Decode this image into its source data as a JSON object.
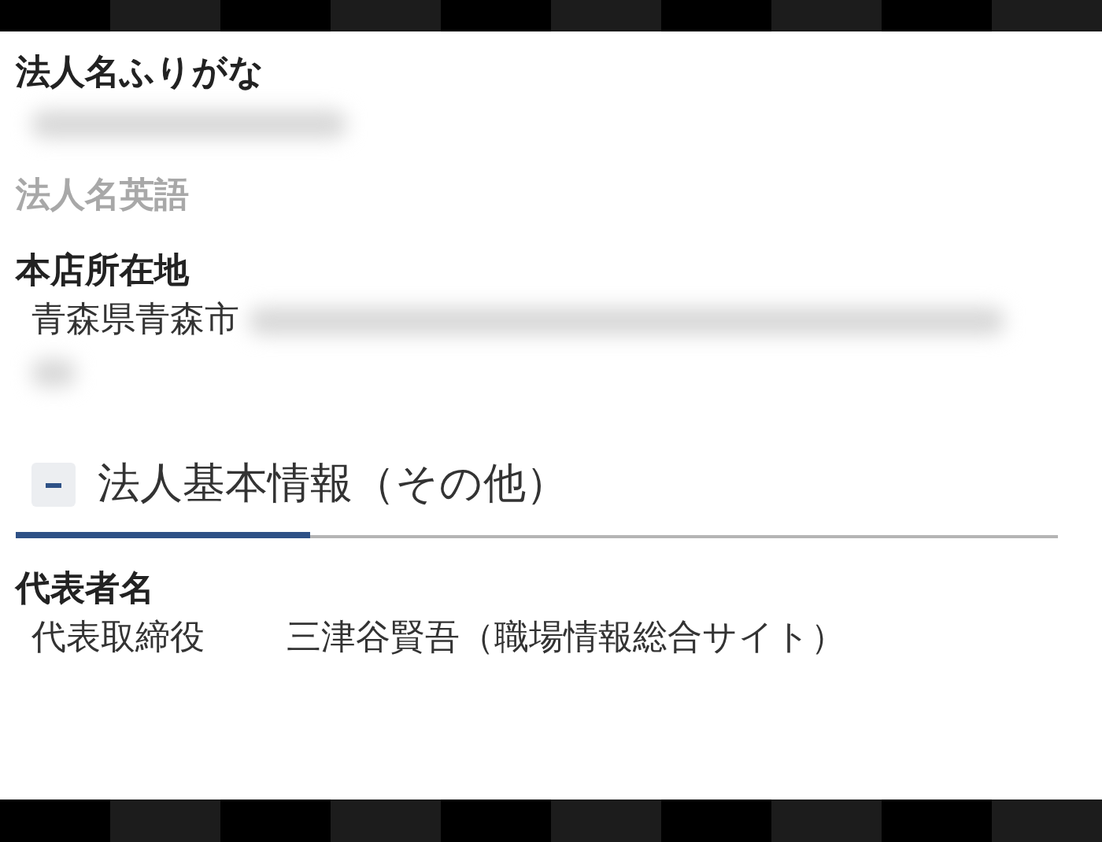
{
  "fields": [
    {
      "label": "法人名ふりがな",
      "muted": false,
      "kind": "blurred"
    },
    {
      "label": "法人名英語",
      "muted": true,
      "kind": "empty"
    },
    {
      "label": "本店所在地",
      "muted": false,
      "kind": "partly_blurred",
      "value": "青森県青森市"
    }
  ],
  "section": {
    "title": "法人基本情報（その他）",
    "expanded": true
  },
  "section_fields": [
    {
      "label": "代表者名",
      "muted": false,
      "value_parts": [
        "代表取締役",
        "三津谷賢吾（職場情報総合サイト）"
      ]
    }
  ]
}
